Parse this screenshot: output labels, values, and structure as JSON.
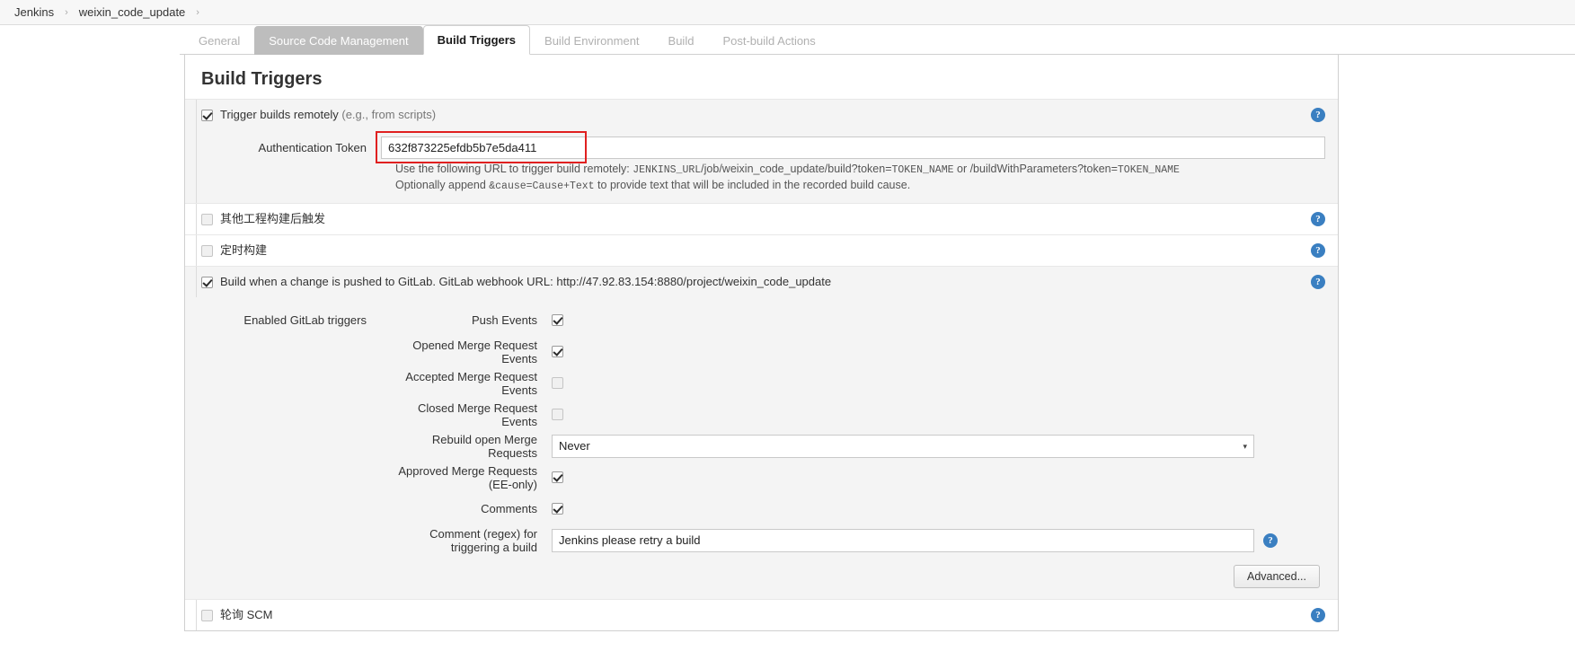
{
  "breadcrumb": {
    "items": [
      "Jenkins",
      "weixin_code_update"
    ],
    "separator": "›"
  },
  "tabs": [
    {
      "label": "General",
      "state": "normal"
    },
    {
      "label": "Source Code Management",
      "state": "hovered"
    },
    {
      "label": "Build Triggers",
      "state": "active"
    },
    {
      "label": "Build Environment",
      "state": "normal"
    },
    {
      "label": "Build",
      "state": "normal"
    },
    {
      "label": "Post-build Actions",
      "state": "normal"
    }
  ],
  "panel": {
    "title": "Build Triggers"
  },
  "triggers": {
    "remote": {
      "label_main": "Trigger builds remotely",
      "label_muted": "(e.g., from scripts)",
      "checked": true,
      "token_label": "Authentication Token",
      "token_value": "632f873225efdb5b7e5da411",
      "help_line1_a": "Use the following URL to trigger build remotely: ",
      "help_line1_mono1": "JENKINS_URL",
      "help_line1_b": "/job/weixin_code_update/build?token=",
      "help_line1_mono2": "TOKEN_NAME",
      "help_line1_c": " or /buildWithParameters?token=",
      "help_line1_mono3": "TOKEN_NAME",
      "help_line2_a": "Optionally append ",
      "help_line2_mono": "&cause=Cause+Text",
      "help_line2_b": " to provide text that will be included in the recorded build cause."
    },
    "after_other_projects": {
      "label": "其他工程构建后触发",
      "checked": false
    },
    "scheduled_build": {
      "label": "定时构建",
      "checked": false
    },
    "gitlab": {
      "label": "Build when a change is pushed to GitLab. GitLab webhook URL: http://47.92.83.154:8880/project/weixin_code_update",
      "checked": true,
      "group_label": "Enabled GitLab triggers",
      "events": [
        {
          "label": "Push Events",
          "checked": true
        },
        {
          "label": "Opened Merge Request Events",
          "checked": true
        },
        {
          "label": "Accepted Merge Request Events",
          "checked": false
        },
        {
          "label": "Closed Merge Request Events",
          "checked": false
        }
      ],
      "rebuild_label": "Rebuild open Merge Requests",
      "rebuild_value": "Never",
      "approved_label": "Approved Merge Requests (EE-only)",
      "approved_checked": true,
      "comments_label": "Comments",
      "comments_checked": true,
      "comment_regex_label": "Comment (regex) for triggering a build",
      "comment_regex_value": "Jenkins please retry a build",
      "advanced_label": "Advanced..."
    },
    "poll_scm": {
      "label": "轮询 SCM",
      "checked": false
    }
  },
  "icons": {
    "help": "?",
    "caret_down": "▾"
  },
  "colors": {
    "accent_blue": "#3a7fc1",
    "highlight_red": "#e02020",
    "tab_hover": "#bdbdbd",
    "shaded_bg": "#f4f4f4"
  }
}
